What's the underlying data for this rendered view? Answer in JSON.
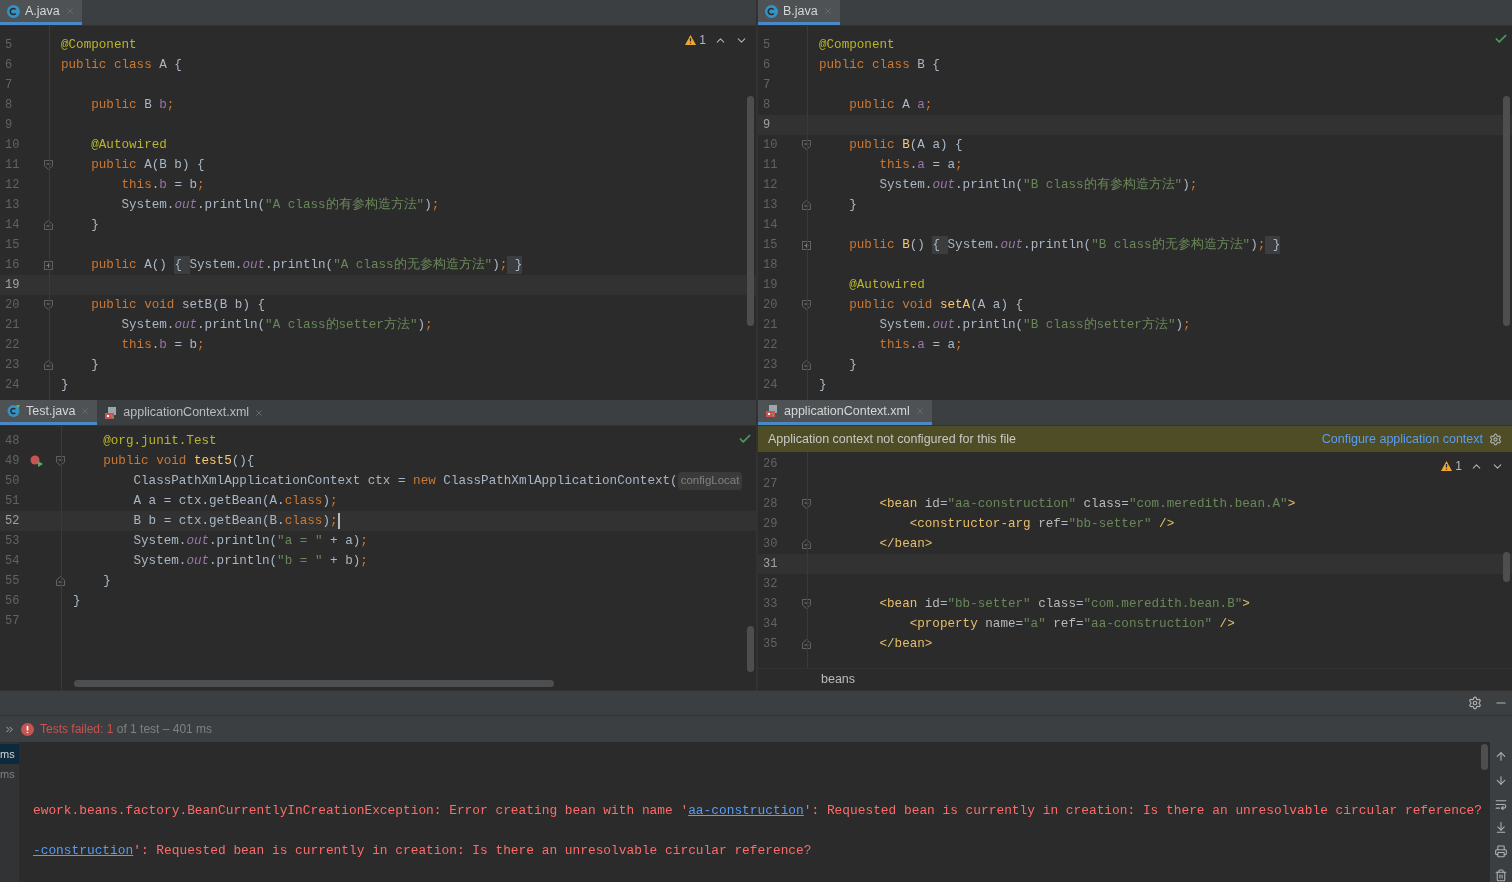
{
  "editors": [
    {
      "tabs": [
        {
          "label": "A.java",
          "kind": "class",
          "selected": true
        }
      ],
      "inspection": {
        "kind": "warning",
        "count": "1"
      },
      "focused": false,
      "lines": [
        {
          "number": "5",
          "current": false,
          "tokens": [
            {
              "kind": "a",
              "text": "@Component"
            }
          ]
        },
        {
          "number": "6",
          "current": false,
          "tokens": [
            {
              "kind": "k",
              "text": "public class "
            },
            {
              "kind": "p",
              "text": "A {"
            }
          ]
        },
        {
          "number": "7",
          "current": false
        },
        {
          "number": "8",
          "current": false,
          "tokens": [
            {
              "kind": "k",
              "text": "    public "
            },
            {
              "kind": "p",
              "text": "B "
            },
            {
              "kind": "f",
              "text": "b"
            },
            {
              "kind": "k",
              "text": ";"
            }
          ]
        },
        {
          "number": "9",
          "current": false
        },
        {
          "number": "10",
          "current": false,
          "tokens": [
            {
              "kind": "a",
              "text": "    @Autowired"
            }
          ]
        },
        {
          "number": "11",
          "current": false,
          "fold": {
            "kind": "open"
          },
          "tokens": [
            {
              "kind": "k",
              "text": "    public "
            },
            {
              "kind": "p",
              "text": "A(B b) {"
            }
          ]
        },
        {
          "number": "12",
          "current": false,
          "tokens": [
            {
              "kind": "k",
              "text": "        this"
            },
            {
              "kind": "p",
              "text": "."
            },
            {
              "kind": "f",
              "text": "b"
            },
            {
              "kind": "p",
              "text": " = b"
            },
            {
              "kind": "k",
              "text": ";"
            }
          ]
        },
        {
          "number": "13",
          "current": false,
          "tokens": [
            {
              "kind": "p",
              "text": "        System."
            },
            {
              "kind": "i",
              "text": "out"
            },
            {
              "kind": "p",
              "text": ".println("
            },
            {
              "kind": "s",
              "text": "\"A class的有参构造方法\""
            },
            {
              "kind": "p",
              "text": ")"
            },
            {
              "kind": "k",
              "text": ";"
            }
          ]
        },
        {
          "number": "14",
          "current": false,
          "fold": {
            "kind": "close"
          },
          "tokens": [
            {
              "kind": "p",
              "text": "    }"
            }
          ]
        },
        {
          "number": "15",
          "current": false
        },
        {
          "number": "16",
          "current": false,
          "fold": {
            "kind": "collapsed"
          },
          "tokens": [
            {
              "kind": "k",
              "text": "    public "
            },
            {
              "kind": "p",
              "text": "A() "
            },
            {
              "kind": "fb",
              "text": "{ "
            },
            {
              "kind": "p",
              "text": "System."
            },
            {
              "kind": "i",
              "text": "out"
            },
            {
              "kind": "p",
              "text": ".println("
            },
            {
              "kind": "s",
              "text": "\"A class的无参构造方法\""
            },
            {
              "kind": "p",
              "text": ")"
            },
            {
              "kind": "k",
              "text": ";"
            },
            {
              "kind": "fb",
              "text": " }"
            }
          ]
        },
        {
          "number": "19",
          "current": true
        },
        {
          "number": "20",
          "current": false,
          "fold": {
            "kind": "open"
          },
          "tokens": [
            {
              "kind": "k",
              "text": "    public void "
            },
            {
              "kind": "p",
              "text": "setB(B b) {"
            }
          ]
        },
        {
          "number": "21",
          "current": false,
          "tokens": [
            {
              "kind": "p",
              "text": "        System."
            },
            {
              "kind": "i",
              "text": "out"
            },
            {
              "kind": "p",
              "text": ".println("
            },
            {
              "kind": "s",
              "text": "\"A class的setter方法\""
            },
            {
              "kind": "p",
              "text": ")"
            },
            {
              "kind": "k",
              "text": ";"
            }
          ]
        },
        {
          "number": "22",
          "current": false,
          "tokens": [
            {
              "kind": "k",
              "text": "        this"
            },
            {
              "kind": "p",
              "text": "."
            },
            {
              "kind": "f",
              "text": "b"
            },
            {
              "kind": "p",
              "text": " = b"
            },
            {
              "kind": "k",
              "text": ";"
            }
          ]
        },
        {
          "number": "23",
          "current": false,
          "fold": {
            "kind": "close"
          },
          "tokens": [
            {
              "kind": "p",
              "text": "    }"
            }
          ]
        },
        {
          "number": "24",
          "current": false,
          "tokens": [
            {
              "kind": "p",
              "text": "}"
            }
          ]
        }
      ]
    },
    {
      "tabs": [
        {
          "label": "B.java",
          "kind": "class",
          "selected": true
        }
      ],
      "inspection": {
        "kind": "ok"
      },
      "focused": false,
      "lines": [
        {
          "number": "5",
          "current": false,
          "tokens": [
            {
              "kind": "a",
              "text": "@Component"
            }
          ]
        },
        {
          "number": "6",
          "current": false,
          "tokens": [
            {
              "kind": "k",
              "text": "public class "
            },
            {
              "kind": "p",
              "text": "B {"
            }
          ]
        },
        {
          "number": "7",
          "current": false
        },
        {
          "number": "8",
          "current": false,
          "tokens": [
            {
              "kind": "k",
              "text": "    public "
            },
            {
              "kind": "p",
              "text": "A "
            },
            {
              "kind": "f",
              "text": "a"
            },
            {
              "kind": "k",
              "text": ";"
            }
          ]
        },
        {
          "number": "9",
          "current": true
        },
        {
          "number": "10",
          "current": false,
          "fold": {
            "kind": "open"
          },
          "tokens": [
            {
              "kind": "k",
              "text": "    public "
            },
            {
              "kind": "m",
              "text": "B"
            },
            {
              "kind": "p",
              "text": "(A a) {"
            }
          ]
        },
        {
          "number": "11",
          "current": false,
          "tokens": [
            {
              "kind": "k",
              "text": "        this"
            },
            {
              "kind": "p",
              "text": "."
            },
            {
              "kind": "f",
              "text": "a"
            },
            {
              "kind": "p",
              "text": " = a"
            },
            {
              "kind": "k",
              "text": ";"
            }
          ]
        },
        {
          "number": "12",
          "current": false,
          "tokens": [
            {
              "kind": "p",
              "text": "        System."
            },
            {
              "kind": "i",
              "text": "out"
            },
            {
              "kind": "p",
              "text": ".println("
            },
            {
              "kind": "s",
              "text": "\"B class的有参构造方法\""
            },
            {
              "kind": "p",
              "text": ")"
            },
            {
              "kind": "k",
              "text": ";"
            }
          ]
        },
        {
          "number": "13",
          "current": false,
          "fold": {
            "kind": "close"
          },
          "tokens": [
            {
              "kind": "p",
              "text": "    }"
            }
          ]
        },
        {
          "number": "14",
          "current": false
        },
        {
          "number": "15",
          "current": false,
          "fold": {
            "kind": "collapsed"
          },
          "tokens": [
            {
              "kind": "k",
              "text": "    public "
            },
            {
              "kind": "m",
              "text": "B"
            },
            {
              "kind": "p",
              "text": "() "
            },
            {
              "kind": "fb",
              "text": "{ "
            },
            {
              "kind": "p",
              "text": "System."
            },
            {
              "kind": "i",
              "text": "out"
            },
            {
              "kind": "p",
              "text": ".println("
            },
            {
              "kind": "s",
              "text": "\"B class的无参构造方法\""
            },
            {
              "kind": "p",
              "text": ")"
            },
            {
              "kind": "k",
              "text": ";"
            },
            {
              "kind": "fb",
              "text": " }"
            }
          ]
        },
        {
          "number": "18",
          "current": false
        },
        {
          "number": "19",
          "current": false,
          "tokens": [
            {
              "kind": "a",
              "text": "    @Autowired"
            }
          ]
        },
        {
          "number": "20",
          "current": false,
          "fold": {
            "kind": "open"
          },
          "tokens": [
            {
              "kind": "k",
              "text": "    public void "
            },
            {
              "kind": "m",
              "text": "setA"
            },
            {
              "kind": "p",
              "text": "(A a) {"
            }
          ]
        },
        {
          "number": "21",
          "current": false,
          "tokens": [
            {
              "kind": "p",
              "text": "        System."
            },
            {
              "kind": "i",
              "text": "out"
            },
            {
              "kind": "p",
              "text": ".println("
            },
            {
              "kind": "s",
              "text": "\"B class的setter方法\""
            },
            {
              "kind": "p",
              "text": ")"
            },
            {
              "kind": "k",
              "text": ";"
            }
          ]
        },
        {
          "number": "22",
          "current": false,
          "tokens": [
            {
              "kind": "k",
              "text": "        this"
            },
            {
              "kind": "p",
              "text": "."
            },
            {
              "kind": "f",
              "text": "a"
            },
            {
              "kind": "p",
              "text": " = a"
            },
            {
              "kind": "k",
              "text": ";"
            }
          ]
        },
        {
          "number": "23",
          "current": false,
          "fold": {
            "kind": "close"
          },
          "tokens": [
            {
              "kind": "p",
              "text": "    }"
            }
          ]
        },
        {
          "number": "24",
          "current": false,
          "tokens": [
            {
              "kind": "p",
              "text": "}"
            }
          ]
        }
      ]
    },
    {
      "tabs": [
        {
          "label": "Test.java",
          "kind": "test",
          "selected": true
        },
        {
          "label": "applicationContext.xml",
          "kind": "xml",
          "selected": false
        }
      ],
      "inspection": {
        "kind": "ok"
      },
      "focused": true,
      "lines": [
        {
          "number": "48",
          "current": false,
          "tokens": [
            {
              "kind": "a",
              "text": "    @org.junit.Test"
            }
          ]
        },
        {
          "number": "49",
          "current": false,
          "marker": {
            "kind": "test-failed"
          },
          "fold": {
            "kind": "open"
          },
          "tokens": [
            {
              "kind": "k",
              "text": "    public void "
            },
            {
              "kind": "m",
              "text": "test5"
            },
            {
              "kind": "p",
              "text": "(){"
            }
          ]
        },
        {
          "number": "50",
          "current": false,
          "tokens": [
            {
              "kind": "p",
              "text": "        ClassPathXmlApplicationContext ctx = "
            },
            {
              "kind": "k",
              "text": "new "
            },
            {
              "kind": "p",
              "text": "ClassPathXmlApplicationContext("
            },
            {
              "kind": "h",
              "text": "configLocat"
            }
          ]
        },
        {
          "number": "51",
          "current": false,
          "tokens": [
            {
              "kind": "p",
              "text": "        A a = ctx.getBean(A."
            },
            {
              "kind": "k",
              "text": "class"
            },
            {
              "kind": "p",
              "text": ")"
            },
            {
              "kind": "k",
              "text": ";"
            }
          ]
        },
        {
          "number": "52",
          "current": true,
          "tokens": [
            {
              "kind": "p",
              "text": "        B b = ctx.getBean(B."
            },
            {
              "kind": "k",
              "text": "class"
            },
            {
              "kind": "p",
              "text": ")"
            },
            {
              "kind": "k",
              "text": ";"
            }
          ]
        },
        {
          "number": "53",
          "current": false,
          "tokens": [
            {
              "kind": "p",
              "text": "        System."
            },
            {
              "kind": "i",
              "text": "out"
            },
            {
              "kind": "p",
              "text": ".println("
            },
            {
              "kind": "s",
              "text": "\"a = \""
            },
            {
              "kind": "p",
              "text": " + a)"
            },
            {
              "kind": "k",
              "text": ";"
            }
          ]
        },
        {
          "number": "54",
          "current": false,
          "tokens": [
            {
              "kind": "p",
              "text": "        System."
            },
            {
              "kind": "i",
              "text": "out"
            },
            {
              "kind": "p",
              "text": ".println("
            },
            {
              "kind": "s",
              "text": "\"b = \""
            },
            {
              "kind": "p",
              "text": " + b)"
            },
            {
              "kind": "k",
              "text": ";"
            }
          ]
        },
        {
          "number": "55",
          "current": false,
          "fold": {
            "kind": "close"
          },
          "tokens": [
            {
              "kind": "p",
              "text": "    }"
            }
          ]
        },
        {
          "number": "56",
          "current": false,
          "tokens": [
            {
              "kind": "p",
              "text": "}"
            }
          ]
        },
        {
          "number": "57",
          "current": false
        }
      ]
    },
    {
      "tabs": [
        {
          "label": "applicationContext.xml",
          "kind": "xml",
          "selected": true
        }
      ],
      "banner": {
        "text": "Application context not configured for this file",
        "link": "Configure application context"
      },
      "inspection": {
        "kind": "warning",
        "count": "1"
      },
      "focused": false,
      "breadcrumb": "beans",
      "lines": [
        {
          "number": "26",
          "current": false
        },
        {
          "number": "27",
          "current": false
        },
        {
          "number": "28",
          "current": false,
          "fold": {
            "kind": "open"
          },
          "tokens": [
            {
              "kind": "t",
              "text": "        <bean "
            },
            {
              "kind": "n",
              "text": "id"
            },
            {
              "kind": "p",
              "text": "="
            },
            {
              "kind": "s",
              "text": "\"aa-construction\""
            },
            {
              "kind": "n",
              "text": " class"
            },
            {
              "kind": "p",
              "text": "="
            },
            {
              "kind": "s",
              "text": "\"com.meredith.bean.A\""
            },
            {
              "kind": "t",
              "text": ">"
            }
          ]
        },
        {
          "number": "29",
          "current": false,
          "tokens": [
            {
              "kind": "t",
              "text": "            <constructor-arg "
            },
            {
              "kind": "n",
              "text": "ref"
            },
            {
              "kind": "p",
              "text": "="
            },
            {
              "kind": "s",
              "text": "\"bb-setter\""
            },
            {
              "kind": "t",
              "text": " />"
            }
          ]
        },
        {
          "number": "30",
          "current": false,
          "fold": {
            "kind": "close"
          },
          "tokens": [
            {
              "kind": "t",
              "text": "        </bean>"
            }
          ]
        },
        {
          "number": "31",
          "current": true
        },
        {
          "number": "32",
          "current": false
        },
        {
          "number": "33",
          "current": false,
          "fold": {
            "kind": "open"
          },
          "tokens": [
            {
              "kind": "t",
              "text": "        <bean "
            },
            {
              "kind": "n",
              "text": "id"
            },
            {
              "kind": "p",
              "text": "="
            },
            {
              "kind": "s",
              "text": "\"bb-setter\""
            },
            {
              "kind": "n",
              "text": " class"
            },
            {
              "kind": "p",
              "text": "="
            },
            {
              "kind": "s",
              "text": "\"com.meredith.bean.B\""
            },
            {
              "kind": "t",
              "text": ">"
            }
          ]
        },
        {
          "number": "34",
          "current": false,
          "tokens": [
            {
              "kind": "t",
              "text": "            <property "
            },
            {
              "kind": "n",
              "text": "name"
            },
            {
              "kind": "p",
              "text": "="
            },
            {
              "kind": "s",
              "text": "\"a\""
            },
            {
              "kind": "n",
              "text": " ref"
            },
            {
              "kind": "p",
              "text": "="
            },
            {
              "kind": "s",
              "text": "\"aa-construction\""
            },
            {
              "kind": "t",
              "text": " />"
            }
          ]
        },
        {
          "number": "35",
          "current": false,
          "fold": {
            "kind": "close"
          },
          "tokens": [
            {
              "kind": "t",
              "text": "        </bean>"
            }
          ]
        }
      ]
    }
  ],
  "run_panel": {
    "status": {
      "failed": "Tests failed: 1",
      "summary": "of 1 test – 401 ms"
    },
    "tree_items": [
      {
        "label": "ms",
        "selected": true
      },
      {
        "label": "ms",
        "selected": false
      }
    ],
    "console": [
      [
        {
          "kind": "text",
          "text": "ework.beans.factory.BeanCurrentlyInCreationException: Error creating bean with name '"
        },
        {
          "kind": "link",
          "text": "aa-construction"
        },
        {
          "kind": "text",
          "text": "': Requested bean is currently in creation: Is there an unresolvable circular reference?"
        }
      ],
      [
        {
          "kind": "link",
          "text": "-construction"
        },
        {
          "kind": "text",
          "text": "': Requested bean is currently in creation: Is there an unresolvable circular reference?"
        }
      ]
    ]
  }
}
